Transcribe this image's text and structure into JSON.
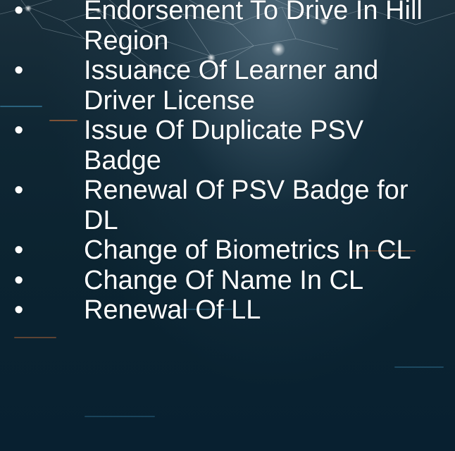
{
  "slide": {
    "bullet_glyph": "•",
    "items": [
      {
        "text": "Endorsement To Drive In Hill Region"
      },
      {
        "text": "Issuance Of Learner and Driver License"
      },
      {
        "text": "Issue Of Duplicate PSV Badge"
      },
      {
        "text": "Renewal Of PSV Badge for DL"
      },
      {
        "text": "Change of Biometrics In CL"
      },
      {
        "text": "Change Of Name In CL"
      },
      {
        "text": "Renewal Of LL"
      }
    ]
  },
  "colors": {
    "text": "#ffffff",
    "background_dark": "#082030",
    "background_light": "#1a2f3b",
    "accent_streak_orange": "#d9763a",
    "accent_streak_blue": "#3f8fb8"
  }
}
